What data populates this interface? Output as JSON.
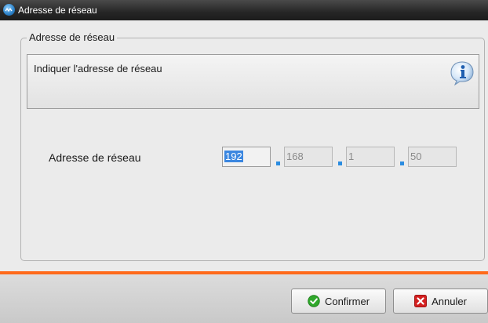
{
  "window": {
    "title": "Adresse de réseau",
    "icon": "app-logo-icon"
  },
  "group": {
    "legend": "Adresse de réseau",
    "info_text": "Indiquer l'adresse de réseau",
    "info_icon": "info-icon"
  },
  "network_address": {
    "label": "Adresse de réseau",
    "octets": [
      "192",
      "168",
      "1",
      "50"
    ]
  },
  "buttons": {
    "confirm": {
      "label": "Confirmer",
      "icon": "check-icon"
    },
    "cancel": {
      "label": "Annuler",
      "icon": "close-icon"
    }
  },
  "colors": {
    "accent_line": "#ff6a1a",
    "selection": "#3b87e0",
    "confirm_icon": "#2fa82b",
    "cancel_icon": "#d42020"
  }
}
